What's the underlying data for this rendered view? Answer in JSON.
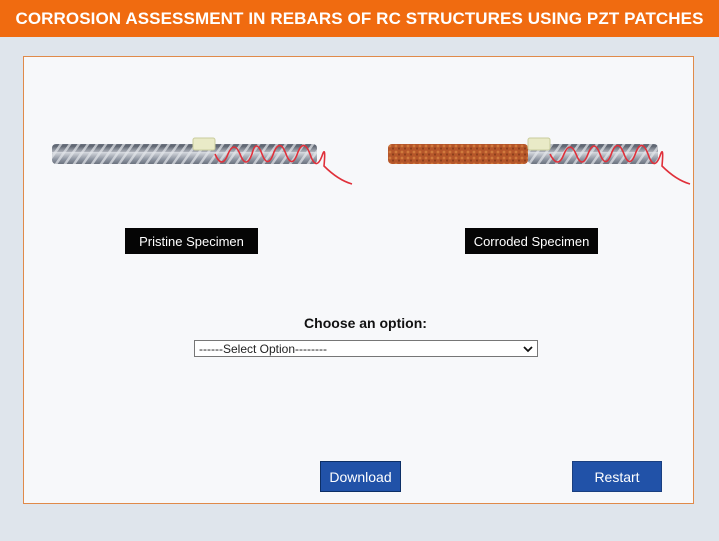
{
  "header": {
    "title": "CORROSION ASSESSMENT IN REBARS OF RC STRUCTURES USING PZT PATCHES"
  },
  "specimens": {
    "pristine_label": "Pristine Specimen",
    "corroded_label": "Corroded Specimen"
  },
  "form": {
    "prompt": "Choose an option:",
    "select_value": "------Select Option--------"
  },
  "buttons": {
    "download": "Download",
    "restart": "Restart"
  },
  "colors": {
    "header": "#f06b10",
    "button": "#2152a8",
    "wire": "#e0303a",
    "rust": "#b5562a"
  }
}
